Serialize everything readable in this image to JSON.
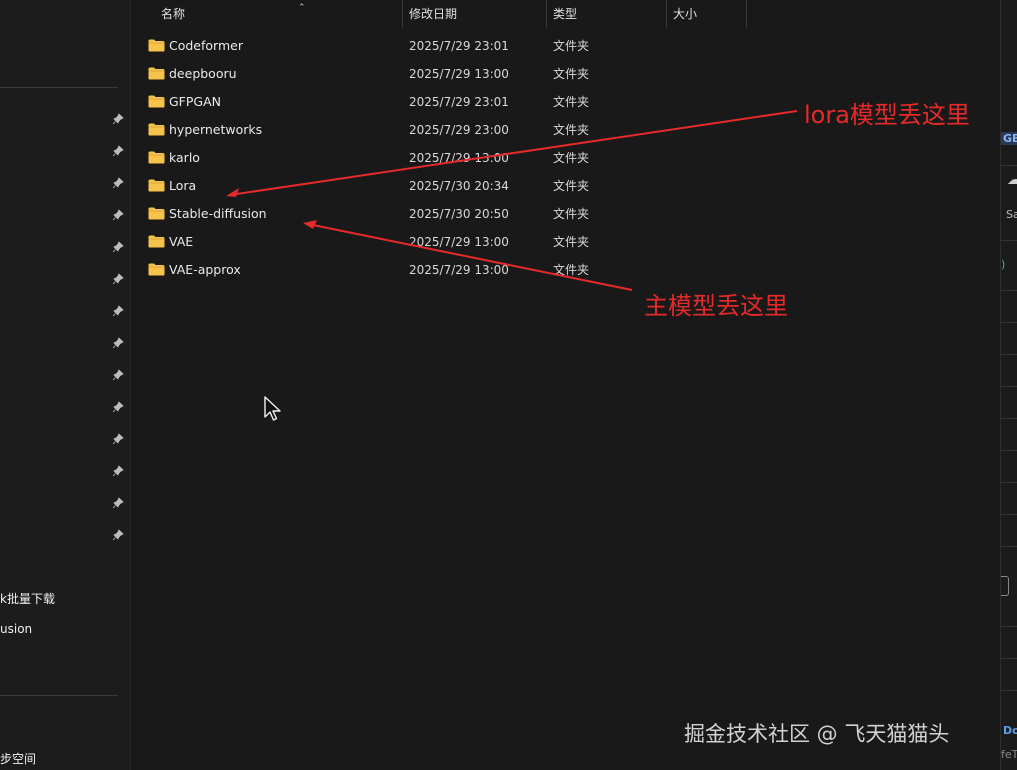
{
  "columns": {
    "name": "名称",
    "modified": "修改日期",
    "type": "类型",
    "size": "大小"
  },
  "files": [
    {
      "name": "Codeformer",
      "modified": "2025/7/29 23:01",
      "type": "文件夹"
    },
    {
      "name": "deepbooru",
      "modified": "2025/7/29 13:00",
      "type": "文件夹"
    },
    {
      "name": "GFPGAN",
      "modified": "2025/7/29 23:01",
      "type": "文件夹"
    },
    {
      "name": "hypernetworks",
      "modified": "2025/7/29 23:00",
      "type": "文件夹"
    },
    {
      "name": "karlo",
      "modified": "2025/7/29 13:00",
      "type": "文件夹"
    },
    {
      "name": "Lora",
      "modified": "2025/7/30 20:34",
      "type": "文件夹"
    },
    {
      "name": "Stable-diffusion",
      "modified": "2025/7/30 20:50",
      "type": "文件夹"
    },
    {
      "name": "VAE",
      "modified": "2025/7/29 13:00",
      "type": "文件夹"
    },
    {
      "name": "VAE-approx",
      "modified": "2025/7/29 13:00",
      "type": "文件夹"
    }
  ],
  "nav": {
    "item_batch_download": "k批量下载",
    "item_diffusion": "usion",
    "item_sync_space": "步空间"
  },
  "annotations": {
    "lora_note": "lora模型丢这里",
    "main_model_note": "主模型丢这里"
  },
  "right_panel": {
    "t1": "GB)",
    "t2": "Sa",
    "t3": "Do",
    "t4": "feT"
  },
  "watermark": "掘金技术社区 @ 飞天猫猫头",
  "colors": {
    "folder": "#f6c24b",
    "annotation": "#e62a2a",
    "background": "#191919"
  }
}
